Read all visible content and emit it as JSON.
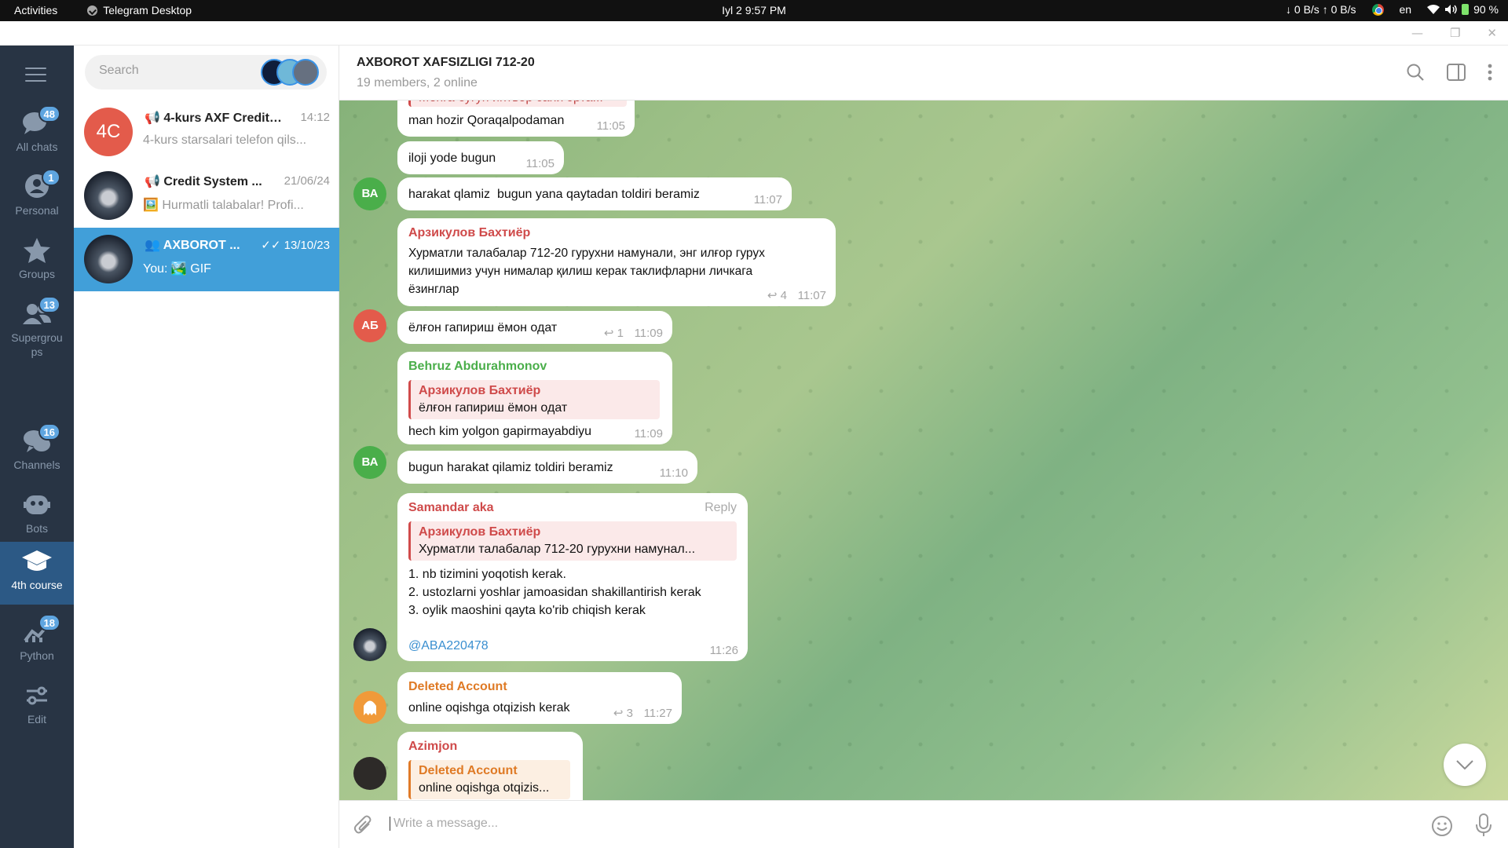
{
  "topbar": {
    "activities": "Activities",
    "app_name": "Telegram Desktop",
    "datetime": "Iyl 2  9:57 PM",
    "network": "↓ 0 B/s ↑ 0 B/s",
    "language": "en",
    "battery": "90 %"
  },
  "folders": [
    {
      "label": "All chats",
      "badge": "48",
      "icon": "chat-bubbles-icon"
    },
    {
      "label": "Personal",
      "badge": "1",
      "icon": "person-icon"
    },
    {
      "label": "Groups",
      "badge": "",
      "icon": "star-icon"
    },
    {
      "label": "Supergrou\nps",
      "badge": "13",
      "icon": "people-icon"
    },
    {
      "label": "Channels",
      "badge": "16",
      "icon": "megaphone-icon"
    },
    {
      "label": "Bots",
      "badge": "",
      "icon": "robot-icon"
    },
    {
      "label": "4th course",
      "badge": "",
      "icon": "graduation-cap-icon",
      "active": true
    },
    {
      "label": "Python",
      "badge": "18",
      "icon": "chart-icon"
    },
    {
      "label": "Edit",
      "badge": "",
      "icon": "sliders-icon"
    }
  ],
  "search": {
    "placeholder": "Search"
  },
  "chats": [
    {
      "initials": "4C",
      "name": "📢 4-kurs AXF Credit_...",
      "date": "14:12",
      "preview": "4-kurs starsalari telefon qils..."
    },
    {
      "initials": "",
      "name": "📢 Credit System ...",
      "date": "21/06/24",
      "preview": "🖼️ Hurmatli talabalar! Profi..."
    },
    {
      "initials": "",
      "name": "👥 AXBOROT ...",
      "date": "✓✓ 13/10/23",
      "preview": "You: 🏞️ GIF"
    }
  ],
  "header": {
    "title": "AXBOROT XAFSIZLIGI 712-20",
    "subtitle": "19 members, 2 online"
  },
  "messages": [
    {
      "partial_quote": "Менга бугун интвор сани эрта...",
      "text": "man hozir Qoraqalpodaman",
      "time": "11:05"
    },
    {
      "text": "iloji yode bugun",
      "time": "11:05"
    },
    {
      "avatar": "ВА",
      "text": "harakat qlamiz  bugun yana qaytadan toldiri beramiz",
      "time": "11:07"
    },
    {
      "sender": "Арзикулов Бахтиёр",
      "text": "Хурматли талабалар 712-20 гурухни намунали, энг илғор гурух\nкилишимиз учун нималар қилиш керак таклифларни личкага\nёзинглар",
      "replies": "4",
      "time": "11:07"
    },
    {
      "avatar": "АБ",
      "text": "ёлғон гапириш ёмон одат",
      "replies": "1",
      "time": "11:09"
    },
    {
      "sender": "Behruz Abdurahmonov",
      "quote_name": "Арзикулов Бахтиёр",
      "quote_text": "ёлғон гапириш ёмон одат",
      "text": "hech kim yolgon gapirmayabdiyu",
      "time": "11:09"
    },
    {
      "avatar": "ВА",
      "text": "bugun harakat qilamiz toldiri beramiz",
      "time": "11:10"
    },
    {
      "sender": "Samandar aka",
      "reply_label": "Reply",
      "quote_name": "Арзикулов Бахтиёр",
      "quote_text": "Хурматли талабалар 712-20 гурухни намунал...",
      "text": "1. nb tizimini yoqotish kerak.\n2. ustozlarni yoshlar jamoasidan shakillantirish kerak\n3. oylik maoshini qayta ko'rib chiqish kerak",
      "mention": "@ABA220478",
      "time": "11:26"
    },
    {
      "sender": "Deleted Account",
      "text": "online oqishga otqizish kerak",
      "replies": "3",
      "time": "11:27"
    },
    {
      "sender": "Azimjon",
      "quote_name": "Deleted Account",
      "quote_text": "online oqishga otqizis..."
    }
  ],
  "composer": {
    "placeholder": "Write a message..."
  },
  "colors": {
    "accent": "#419fd9",
    "folder_bg": "#283444",
    "badge": "#5ea5e0",
    "sender_red": "#cf4a4a",
    "sender_green": "#4aae4a",
    "sender_orange": "#df7a25"
  }
}
